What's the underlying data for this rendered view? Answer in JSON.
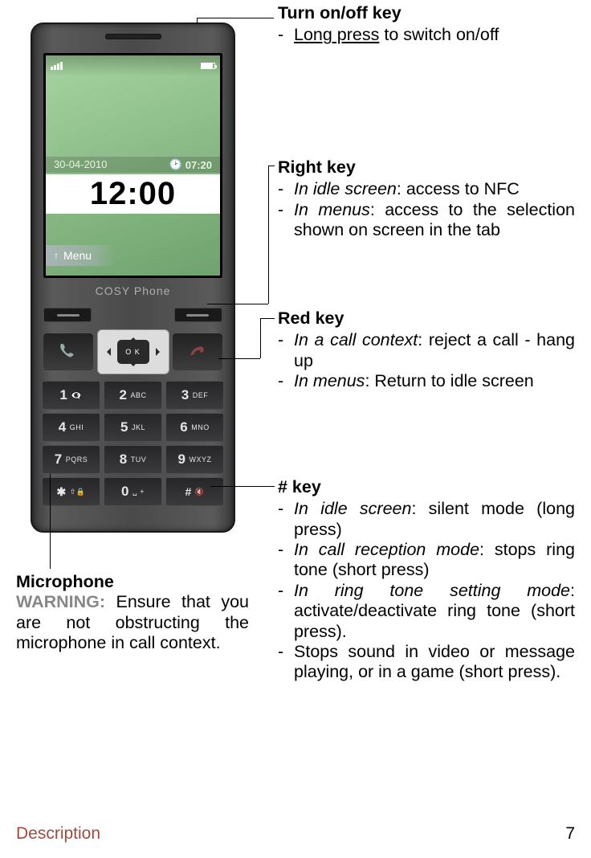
{
  "phone": {
    "status_date": "30-04-2010",
    "status_time": "07:20",
    "clock": "12:00",
    "menu_tab": "Menu",
    "brand": "COSY Phone",
    "ok": "O K",
    "keys": [
      {
        "num": "1",
        "lbl": ""
      },
      {
        "num": "2",
        "lbl": "ABC"
      },
      {
        "num": "3",
        "lbl": "DEF"
      },
      {
        "num": "4",
        "lbl": "GHI"
      },
      {
        "num": "5",
        "lbl": "JKL"
      },
      {
        "num": "6",
        "lbl": "MNO"
      },
      {
        "num": "7",
        "lbl": "PQRS"
      },
      {
        "num": "8",
        "lbl": "TUV"
      },
      {
        "num": "9",
        "lbl": "WXYZ"
      }
    ],
    "star": "✱",
    "star_sub": "⇧ 🔒",
    "zero_num": "0",
    "zero_sub": "␣ +",
    "hash": "#",
    "hash_sub": "🔇"
  },
  "sections": {
    "turnonoff": {
      "title": "Turn on/off key",
      "items": [
        {
          "italic": "",
          "underline": "Long press",
          "rest": " to switch on/off"
        }
      ]
    },
    "rightkey": {
      "title": "Right key",
      "items": [
        {
          "italic": "In idle screen",
          "rest": ": access to NFC"
        },
        {
          "italic": "In menus",
          "rest": ": access to the selection shown on screen in the tab"
        }
      ]
    },
    "redkey": {
      "title": "Red key",
      "items": [
        {
          "italic": "In a call context",
          "rest": ": reject a call - hang up"
        },
        {
          "italic": "In menus",
          "rest": ": Return to idle screen"
        }
      ]
    },
    "hashkey": {
      "title": "# key",
      "items": [
        {
          "italic": "In idle screen",
          "rest": ": silent mode (long press)"
        },
        {
          "italic": "In call reception mode",
          "rest": ": stops ring tone (short press)"
        },
        {
          "italic": "In ring tone setting mode",
          "rest": ": activate/deactivate ring tone (short press)."
        },
        {
          "italic": "",
          "rest": "Stops sound in video or message playing, or in a game (short press)."
        }
      ]
    },
    "microphone": {
      "title": "Microphone",
      "warn_label": "WARNING:",
      "warn_body": " Ensure that you are not obstructing the microphone in call context."
    }
  },
  "footer": {
    "section": "Description",
    "page": "7"
  }
}
